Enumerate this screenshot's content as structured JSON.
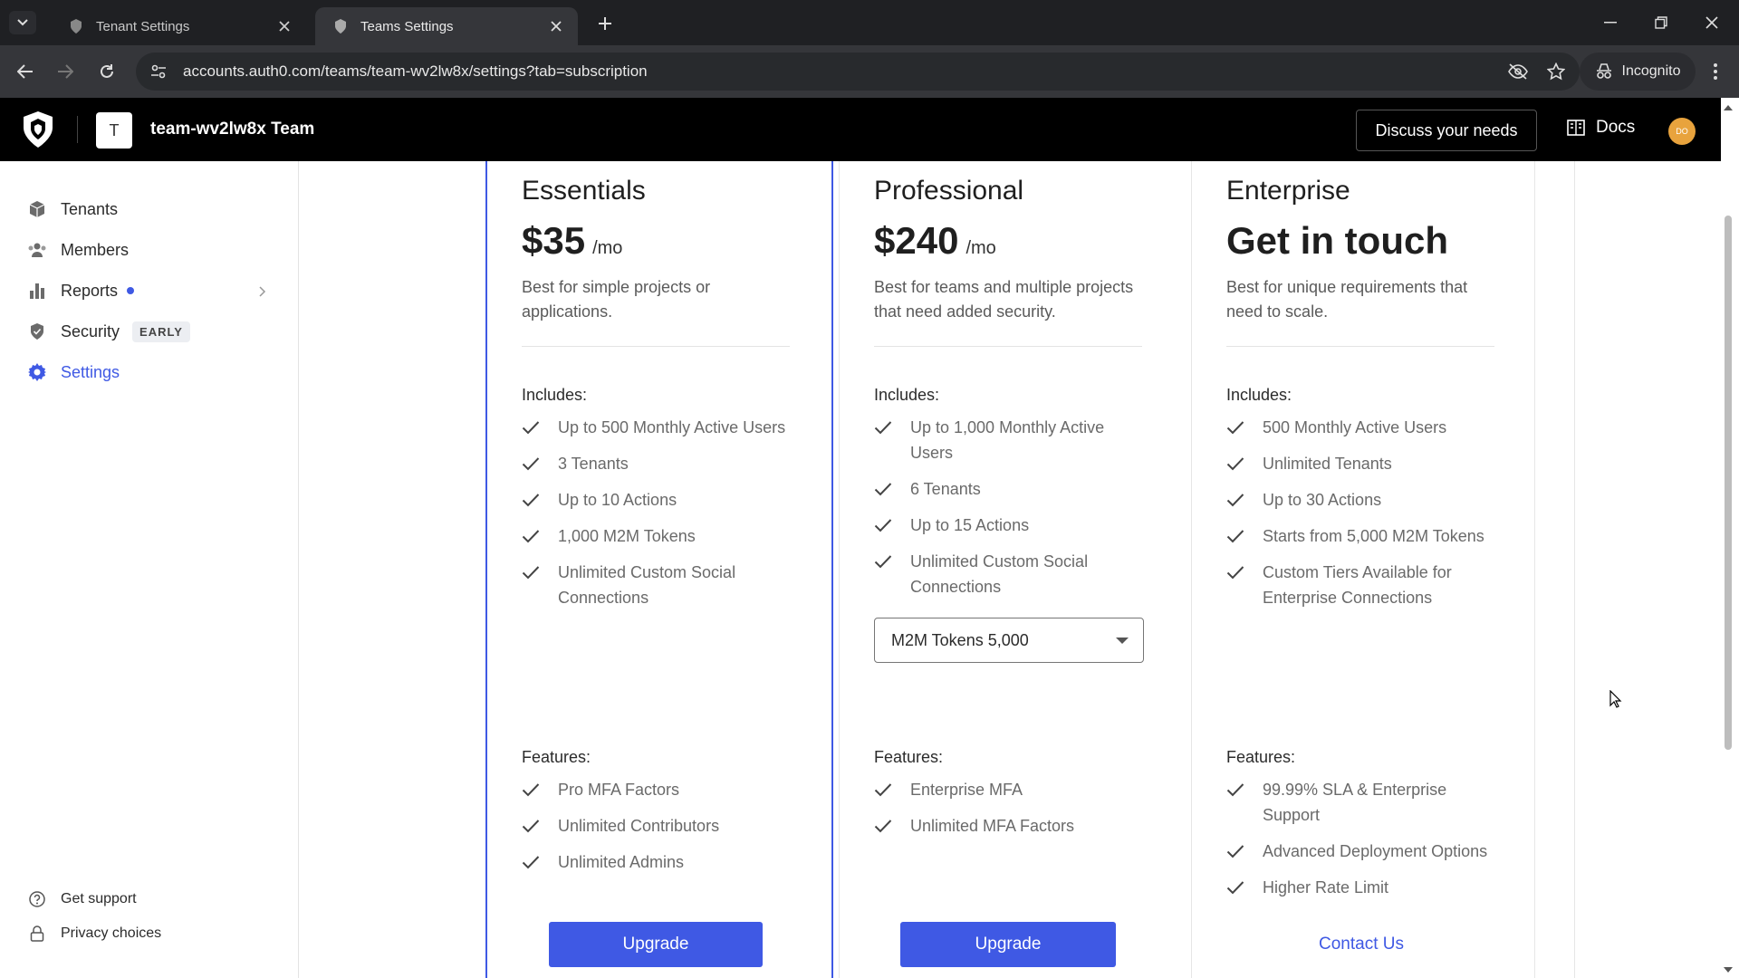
{
  "browser": {
    "tabs": [
      {
        "title": "Tenant Settings",
        "active": false
      },
      {
        "title": "Teams Settings",
        "active": true
      }
    ],
    "url": "accounts.auth0.com/teams/team-wv2lw8x/settings?tab=subscription",
    "incognito_label": "Incognito"
  },
  "header": {
    "team_initial": "T",
    "team_name": "team-wv2lw8x Team",
    "discuss_label": "Discuss your needs",
    "docs_label": "Docs",
    "user_initials": "DO"
  },
  "sidebar": {
    "items": [
      {
        "label": "Tenants",
        "icon": "cube-icon"
      },
      {
        "label": "Members",
        "icon": "users-icon"
      },
      {
        "label": "Reports",
        "icon": "bar-chart-icon"
      },
      {
        "label": "Security",
        "icon": "shield-icon",
        "badge": "EARLY"
      },
      {
        "label": "Settings",
        "icon": "gear-icon",
        "active": true
      }
    ],
    "footer": [
      {
        "label": "Get support",
        "icon": "help-circle-icon"
      },
      {
        "label": "Privacy choices",
        "icon": "lock-icon"
      }
    ]
  },
  "plans": [
    {
      "name": "Essentials",
      "price": "$35",
      "period": "/mo",
      "description": "Best for simple projects or applications.",
      "includes_label": "Includes:",
      "includes": [
        "Up to 500 Monthly Active Users",
        "3 Tenants",
        "Up to 10 Actions",
        "1,000 M2M Tokens",
        "Unlimited Custom Social Connections"
      ],
      "features_label": "Features:",
      "features": [
        "Pro MFA Factors",
        "Unlimited Contributors",
        "Unlimited Admins"
      ],
      "cta": "Upgrade"
    },
    {
      "name": "Professional",
      "price": "$240",
      "period": "/mo",
      "description": "Best for teams and multiple projects that need added security.",
      "includes_label": "Includes:",
      "includes": [
        "Up to 1,000 Monthly Active Users",
        "6 Tenants",
        "Up to 15 Actions",
        "Unlimited Custom Social Connections"
      ],
      "select_value": "M2M Tokens 5,000",
      "features_label": "Features:",
      "features": [
        "Enterprise MFA",
        "Unlimited MFA Factors"
      ],
      "cta": "Upgrade"
    },
    {
      "name": "Enterprise",
      "price": "Get in touch",
      "period": "",
      "description": "Best for unique requirements that need to scale.",
      "includes_label": "Includes:",
      "includes": [
        "500 Monthly Active Users",
        "Unlimited Tenants",
        "Up to 30 Actions",
        "Starts from 5,000 M2M Tokens",
        "Custom Tiers Available for Enterprise Connections"
      ],
      "features_label": "Features:",
      "features": [
        "99.99% SLA & Enterprise Support",
        "Advanced Deployment Options",
        "Higher Rate Limit"
      ],
      "cta": "Contact Us"
    }
  ],
  "colors": {
    "accent": "#3f59e4",
    "header_bg": "#000000",
    "avatar": "#e8a33d"
  }
}
